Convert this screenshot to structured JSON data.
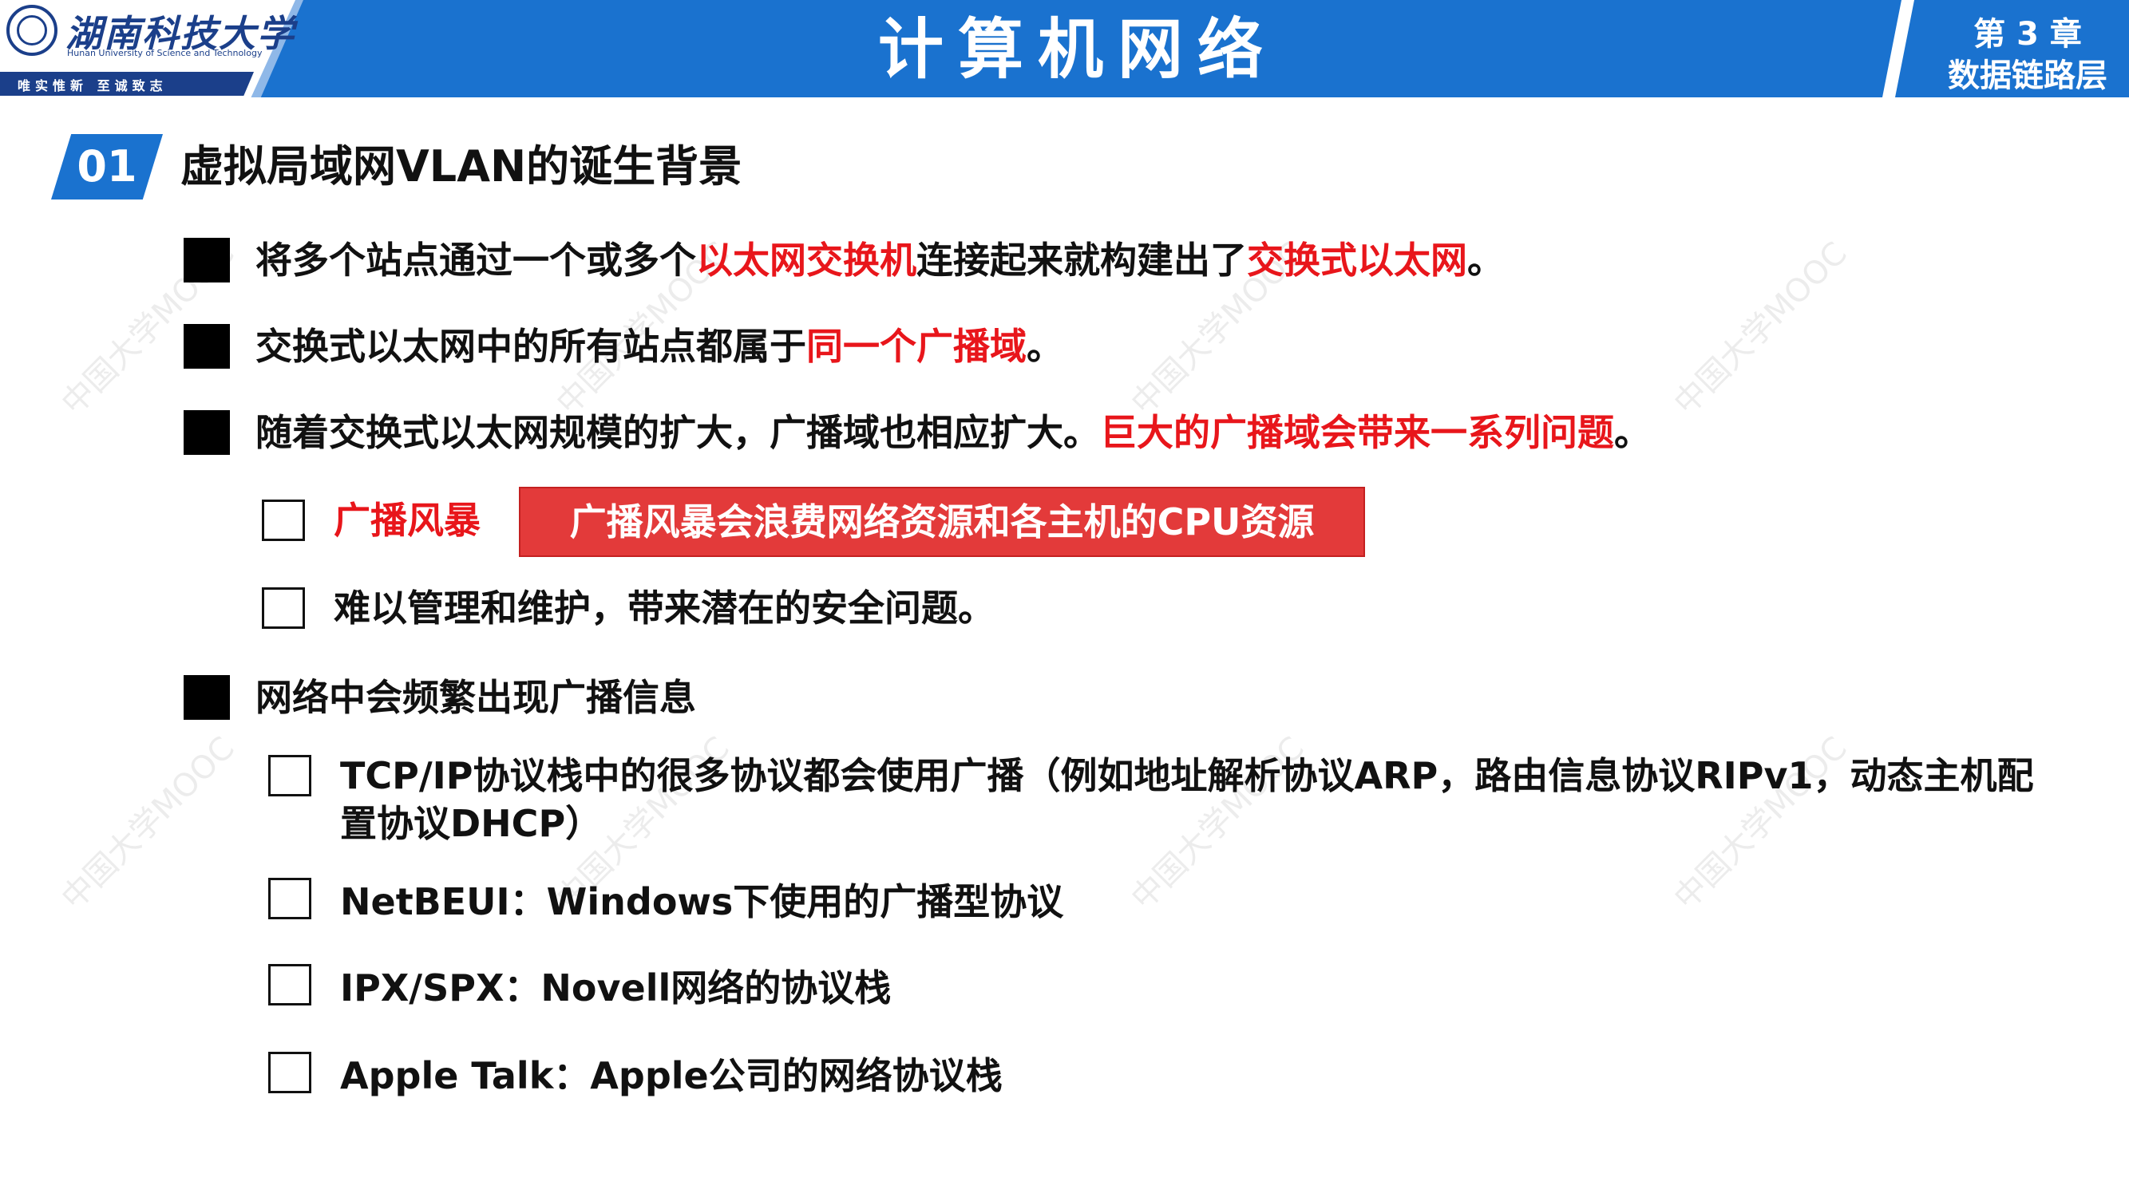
{
  "header": {
    "university_cn": "湖南科技大学",
    "university_en": "Hunan University of Science and Technology",
    "motto": "唯实惟新  至诚致志",
    "course_title": "计算机网络",
    "chapter": "第 3 章",
    "chapter_name": "数据链路层"
  },
  "section": {
    "number": "01",
    "title": "虚拟局域网VLAN的诞生背景"
  },
  "bullets": [
    {
      "parts": [
        {
          "text": "将多个站点通过一个或多个",
          "red": false
        },
        {
          "text": "以太网交换机",
          "red": true
        },
        {
          "text": "连接起来就构建出了",
          "red": false
        },
        {
          "text": "交换式以太网",
          "red": true
        },
        {
          "text": "。",
          "red": false
        }
      ]
    },
    {
      "parts": [
        {
          "text": "交换式以太网中的所有站点都属于",
          "red": false
        },
        {
          "text": "同一个广播域",
          "red": true
        },
        {
          "text": "。",
          "red": false
        }
      ]
    },
    {
      "parts": [
        {
          "text": "随着交换式以太网规模的扩大，广播域也相应扩大。",
          "red": false
        },
        {
          "text": "巨大的广播域会带来一系列问题",
          "red": true
        },
        {
          "text": "。",
          "red": false
        }
      ]
    },
    {
      "parts": [
        {
          "text": "网络中会频繁出现广播信息",
          "red": false
        }
      ]
    }
  ],
  "problems": {
    "item1_label": "广播风暴",
    "item1_callout": "广播风暴会浪费网络资源和各主机的CPU资源",
    "item2": "难以管理和维护，带来潜在的安全问题。"
  },
  "protocols": [
    "TCP/IP协议栈中的很多协议都会使用广播（例如地址解析协议ARP，路由信息协议RIPv1，动态主机配置协议DHCP）",
    "NetBEUI：Windows下使用的广播型协议",
    "IPX/SPX：Novell网络的协议栈",
    "Apple Talk：Apple公司的网络协议栈"
  ],
  "watermark": "中国大学MOOC",
  "colors": {
    "accent_blue": "#1a72cf",
    "highlight_red": "#e8161b",
    "callout_red": "#e33a3a"
  }
}
